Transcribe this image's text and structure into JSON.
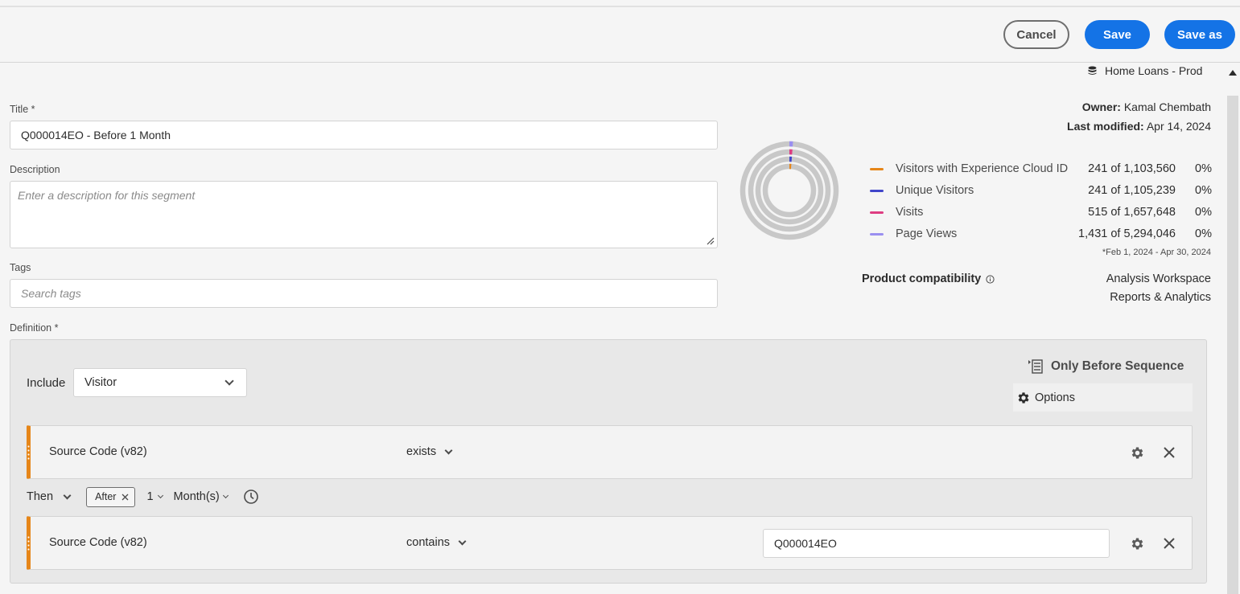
{
  "toolbar": {
    "cancel_label": "Cancel",
    "save_label": "Save",
    "save_as_label": "Save as"
  },
  "form": {
    "title_label": "Title",
    "title_value": "Q000014EO - Before 1 Month",
    "description_label": "Description",
    "description_placeholder": "Enter a description for this segment",
    "tags_label": "Tags",
    "tags_placeholder": "Search tags",
    "definition_label": "Definition",
    "required_marker": "*"
  },
  "info": {
    "data_source": "Home Loans - Prod",
    "owner_label": "Owner:",
    "owner_value": "Kamal Chembath",
    "modified_label": "Last modified:",
    "modified_value": "Apr 14, 2024",
    "date_range_note": "*Feb 1, 2024 - Apr 30, 2024",
    "product_compat_label": "Product compatibility",
    "products": [
      "Analysis Workspace",
      "Reports & Analytics"
    ]
  },
  "metrics": [
    {
      "name": "Visitors with Experience Cloud ID",
      "value": "241 of 1,103,560",
      "pct": "0%",
      "color": "#e68619",
      "fraction": 0.0002
    },
    {
      "name": "Unique Visitors",
      "value": "241 of 1,105,239",
      "pct": "0%",
      "color": "#4046ca",
      "fraction": 0.0002
    },
    {
      "name": "Visits",
      "value": "515 of 1,657,648",
      "pct": "0%",
      "color": "#de3d82",
      "fraction": 0.0003
    },
    {
      "name": "Page Views",
      "value": "1,431 of 5,294,046",
      "pct": "0%",
      "color": "#9a8ff0",
      "fraction": 0.0003
    }
  ],
  "definition": {
    "include_label": "Include",
    "include_value": "Visitor",
    "sequence_label": "Only Before Sequence",
    "options_label": "Options",
    "rules": [
      {
        "dimension": "Source Code (v82)",
        "operator": "exists",
        "value": ""
      },
      {
        "dimension": "Source Code (v82)",
        "operator": "contains",
        "value": "Q000014EO"
      }
    ],
    "then": {
      "label": "Then",
      "chip_label": "After",
      "count": "1",
      "unit": "Month(s)"
    }
  }
}
